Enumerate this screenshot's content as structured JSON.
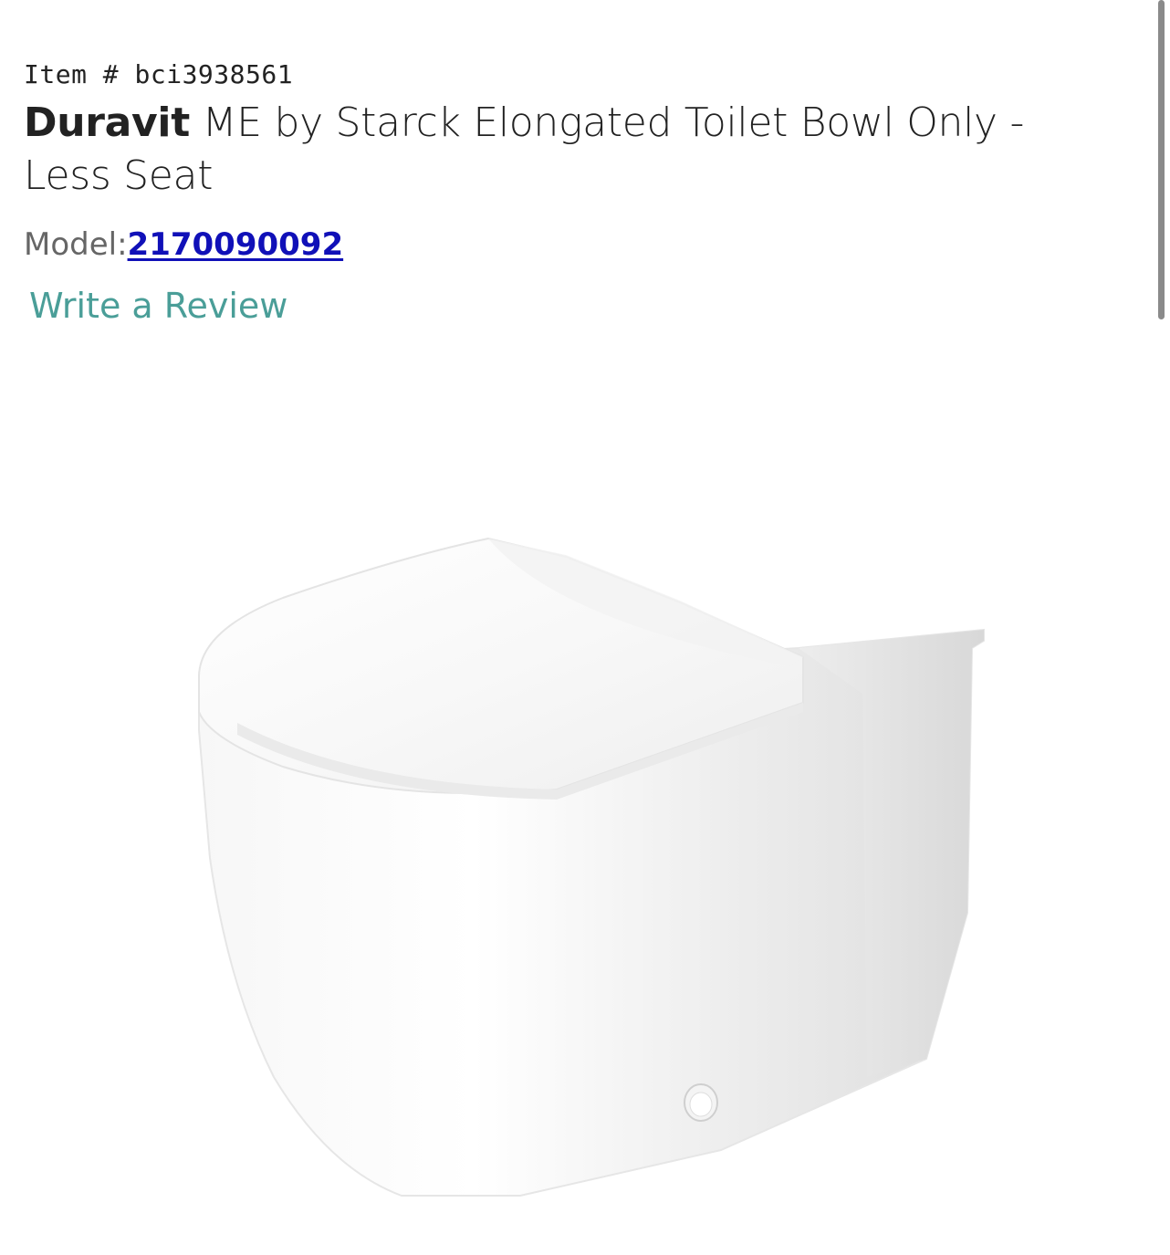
{
  "product": {
    "item_number": "Item # bci3938561",
    "brand": "Duravit",
    "title_rest": " ME by Starck Elongated Toilet Bowl Only - Less Seat",
    "model_label": "Model:",
    "model_number": "2170090092",
    "review_link": "Write a Review",
    "image_alt": "white-toilet-bowl-image"
  },
  "colors": {
    "model_link": "#1010b8",
    "review_link": "#4a9e98",
    "text": "#222222",
    "secondary_text": "#666666"
  }
}
